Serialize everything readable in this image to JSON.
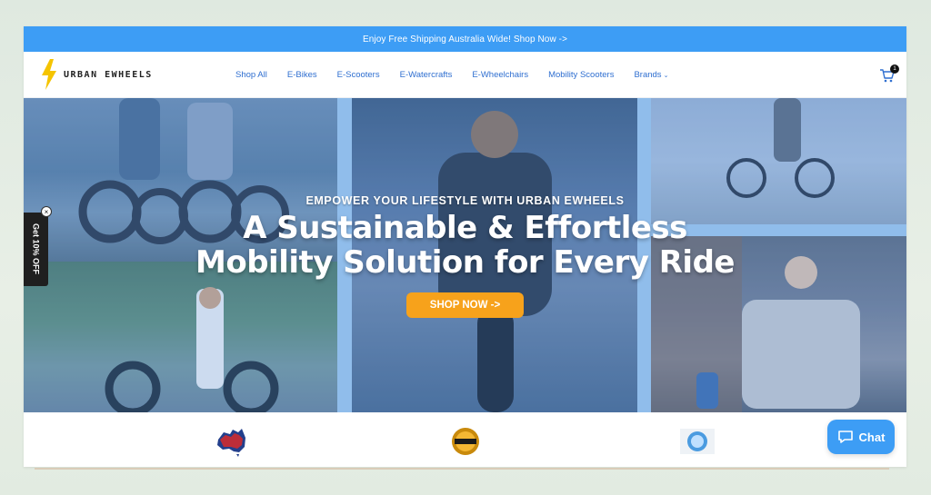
{
  "announcement": {
    "text": "Enjoy Free Shipping Australia Wide! Shop Now ->"
  },
  "logo": {
    "text": "URBAN EWHEELS",
    "icon": "lightning-bolt-icon",
    "bolt_color": "#f5c400"
  },
  "nav": {
    "items": [
      "Shop All",
      "E-Bikes",
      "E-Scooters",
      "E-Watercrafts",
      "E-Wheelchairs",
      "Mobility Scooters",
      "Brands"
    ]
  },
  "cart": {
    "icon": "cart-icon",
    "count": "1"
  },
  "hero": {
    "kicker": "EMPOWER YOUR LIFESTYLE WITH URBAN EWHEELS",
    "title_line1": "A Sustainable & Effortless",
    "title_line2": "Mobility Solution for Every Ride",
    "cta": "SHOP NOW ->",
    "cta_color": "#f7a21b"
  },
  "side_tab": {
    "label": "Get 10% OFF",
    "close": "×"
  },
  "trust_badges": [
    "australia-map-icon",
    "price-match-badge-icon",
    "certified-seal-icon"
  ],
  "chat": {
    "label": "Chat",
    "icon": "chat-bubble-icon"
  },
  "colors": {
    "accent": "#3d9df5",
    "nav_link": "#2f6fd0"
  }
}
